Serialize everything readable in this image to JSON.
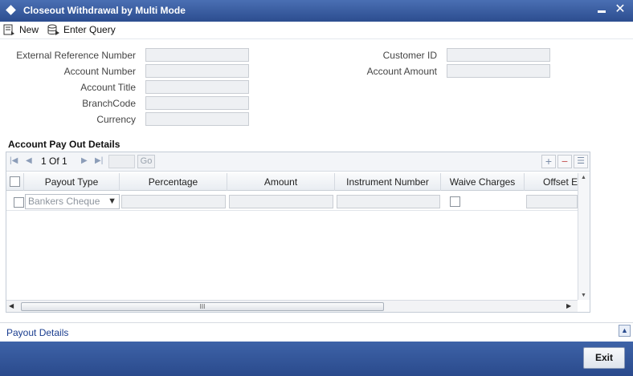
{
  "window": {
    "title": "Closeout Withdrawal by Multi Mode"
  },
  "toolbar": {
    "new_label": "New",
    "enter_query_label": "Enter Query"
  },
  "form": {
    "external_reference_number": {
      "label": "External Reference Number",
      "value": ""
    },
    "account_number": {
      "label": "Account Number",
      "value": ""
    },
    "account_title": {
      "label": "Account Title",
      "value": ""
    },
    "branch_code": {
      "label": "BranchCode",
      "value": ""
    },
    "currency": {
      "label": "Currency",
      "value": ""
    },
    "customer_id": {
      "label": "Customer ID",
      "value": ""
    },
    "account_amount": {
      "label": "Account Amount",
      "value": ""
    }
  },
  "payout_section": {
    "title": "Account Pay Out Details",
    "pagination": {
      "page_text": "1 Of 1",
      "go_label": "Go"
    },
    "columns": [
      "Payout Type",
      "Percentage",
      "Amount",
      "Instrument Number",
      "Waive Charges",
      "Offset E"
    ],
    "rows": [
      {
        "payout_type": "Bankers Cheque",
        "percentage": "",
        "amount": "",
        "instrument_number": "",
        "waive_charges": false,
        "offset": ""
      }
    ],
    "scroll_grip": "III"
  },
  "payout_details_link": "Payout Details",
  "footer": {
    "exit_label": "Exit"
  }
}
